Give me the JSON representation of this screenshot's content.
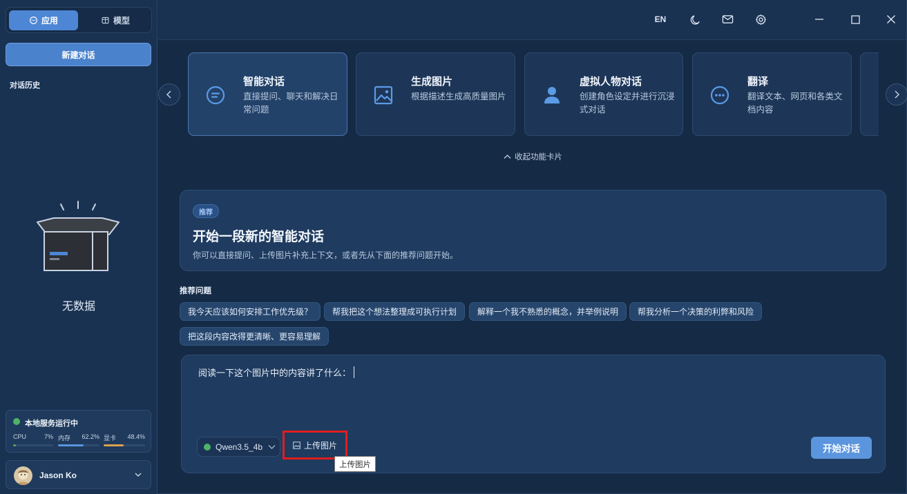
{
  "sidebar": {
    "tabs": [
      {
        "label": "应用",
        "icon": "chat-bubble-icon"
      },
      {
        "label": "模型",
        "icon": "cube-icon"
      }
    ],
    "new_chat": "新建对话",
    "history_title": "对话历史",
    "empty_text": "无数据",
    "status": {
      "title": "本地服务运行中",
      "metrics": [
        {
          "label": "CPU",
          "value": "7%",
          "level": 0.07,
          "color": "#5aa35f"
        },
        {
          "label": "内存",
          "value": "62.2%",
          "level": 0.622,
          "color": "#5b95dd"
        },
        {
          "label": "显卡",
          "value": "48.4%",
          "level": 0.484,
          "color": "#d9a34e"
        }
      ]
    },
    "user": {
      "name": "Jason Ko"
    }
  },
  "titlebar": {
    "lang": "EN",
    "icons": [
      "moon-icon",
      "mail-icon",
      "settings-icon",
      "minimize-icon",
      "maximize-icon",
      "close-icon"
    ]
  },
  "features": [
    {
      "title": "智能对话",
      "desc": "直接提问、聊天和解决日常问题",
      "icon": "chat-icon"
    },
    {
      "title": "生成图片",
      "desc": "根据描述生成高质量图片",
      "icon": "image-icon"
    },
    {
      "title": "虚拟人物对话",
      "desc": "创建角色设定并进行沉浸式对话",
      "icon": "person-icon"
    },
    {
      "title": "翻译",
      "desc": "翻译文本、网页和各类文档内容",
      "icon": "dots-chat-icon"
    }
  ],
  "collapse_label": "收起功能卡片",
  "hero": {
    "tag": "推荐",
    "title": "开始一段新的智能对话",
    "subtitle": "你可以直接提问、上传图片补充上下文，或者先从下面的推荐问题开始。"
  },
  "recommend": {
    "title": "推荐问题",
    "items": [
      "我今天应该如何安排工作优先级？",
      "帮我把这个想法整理成可执行计划",
      "解释一个我不熟悉的概念，并举例说明",
      "帮我分析一个决策的利弊和风险",
      "把这段内容改得更清晰、更容易理解"
    ]
  },
  "input": {
    "value": "阅读一下这个图片中的内容讲了什么：",
    "model": "Qwen3.5_4b",
    "upload_label": "上传图片",
    "start_label": "开始对话",
    "tooltip": "上传图片"
  }
}
